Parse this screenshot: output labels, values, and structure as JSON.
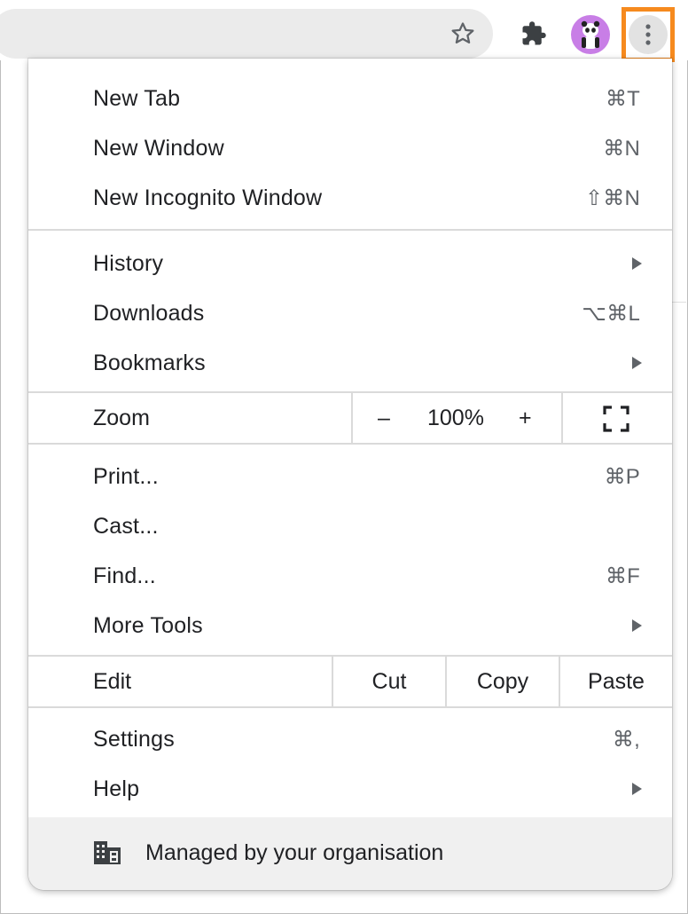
{
  "toolbar": {
    "icons": [
      "star-icon",
      "puzzle-icon",
      "avatar",
      "more-vertical-icon"
    ],
    "accent_color": "#f68a1e",
    "avatar_color": "#c87ee6"
  },
  "menu": {
    "new_tab": {
      "label": "New Tab",
      "shortcut": "⌘T"
    },
    "new_window": {
      "label": "New Window",
      "shortcut": "⌘N"
    },
    "new_incognito": {
      "label": "New Incognito Window",
      "shortcut": "⇧⌘N"
    },
    "history": {
      "label": "History"
    },
    "downloads": {
      "label": "Downloads",
      "shortcut": "⌥⌘L"
    },
    "bookmarks": {
      "label": "Bookmarks"
    },
    "zoom": {
      "label": "Zoom",
      "minus": "–",
      "value": "100%",
      "plus": "+"
    },
    "print": {
      "label": "Print...",
      "shortcut": "⌘P"
    },
    "cast": {
      "label": "Cast..."
    },
    "find": {
      "label": "Find...",
      "shortcut": "⌘F"
    },
    "more_tools": {
      "label": "More Tools"
    },
    "edit": {
      "label": "Edit",
      "cut": "Cut",
      "copy": "Copy",
      "paste": "Paste"
    },
    "settings": {
      "label": "Settings",
      "shortcut": "⌘,"
    },
    "help": {
      "label": "Help"
    },
    "managed": {
      "label": "Managed by your organisation"
    }
  }
}
